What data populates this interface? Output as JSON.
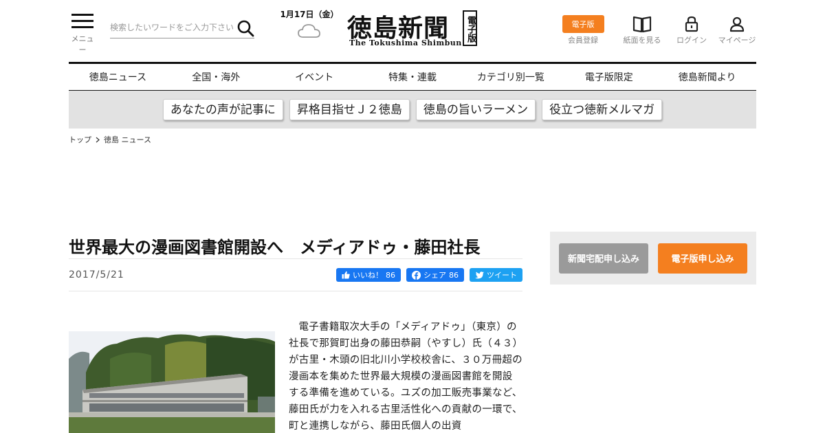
{
  "header": {
    "menu_label": "メニュー",
    "search_placeholder": "検索したいワードをご入力下さい",
    "date": "1月17日（金）",
    "weather_icon": "cloud-icon",
    "logo_jp": "徳島新聞",
    "logo_en": "The Tokushima Shimbun",
    "logo_edition": "電子版",
    "actions": {
      "digital_badge": "電子版",
      "register": "会員登録",
      "paper_view": "紙面を見る",
      "login": "ログイン",
      "mypage": "マイページ"
    }
  },
  "nav": {
    "items": [
      "徳島ニュース",
      "全国・海外",
      "イベント",
      "特集・連載",
      "カテゴリ別一覧",
      "電子版限定",
      "徳島新聞より"
    ]
  },
  "subnav": {
    "items": [
      "あなたの声が記事に",
      "昇格目指せＪ２徳島",
      "徳島の旨いラーメン",
      "役立つ徳新メルマガ"
    ]
  },
  "breadcrumb": {
    "top": "トップ",
    "current": "徳島 ニュース"
  },
  "article": {
    "title": "世界最大の漫画図書館開設へ　メディアドゥ・藤田社長",
    "date": "2017/5/21",
    "body": "電子書籍取次大手の「メディアドゥ」（東京）の社長で那賀町出身の藤田恭嗣（やすし）氏（４３）が古里・木頭の旧北川小学校校舎に、３０万冊超の漫画本を集めた世界最大規模の漫画図書館を開設する準備を進めている。ユズの加工販売事業など、藤田氏が力を入れる古里活性化への貢献の一環で、町と連携しながら、藤田氏個人の出資"
  },
  "social": {
    "like_label": "いいね！",
    "like_count": "86",
    "share_label": "シェア",
    "share_count": "86",
    "tweet_label": "ツイート"
  },
  "sidebar": {
    "home_delivery": "新聞宅配申し込み",
    "digital_apply": "電子版申し込み"
  },
  "colors": {
    "accent": "#f47f1f",
    "facebook": "#1877f2",
    "twitter": "#1da1f2"
  }
}
